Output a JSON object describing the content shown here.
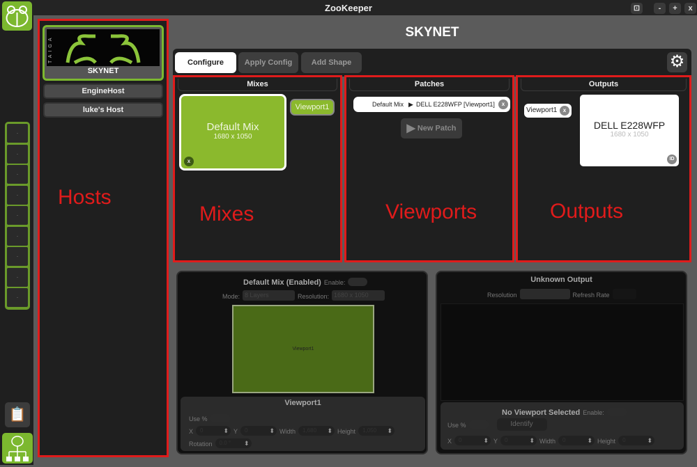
{
  "app": {
    "title": "ZooKeeper",
    "window_buttons": [
      "-",
      "+",
      "x"
    ]
  },
  "sidebar": {
    "slots": [
      ".",
      ".",
      ".",
      ".",
      ".",
      ".",
      ".",
      ".",
      "."
    ]
  },
  "hosts": {
    "items": [
      {
        "label": "SKYNET",
        "selected": true
      },
      {
        "label": "EngineHost"
      },
      {
        "label": "luke's Host"
      }
    ],
    "thumbnail_text": "TAIGA"
  },
  "annotations": {
    "hosts": "Hosts",
    "mixes": "Mixes",
    "viewports": "Viewports",
    "outputs": "Outputs"
  },
  "header": {
    "title": "SKYNET"
  },
  "toolbar": {
    "tabs": [
      {
        "label": "Configure",
        "active": true
      },
      {
        "label": "Apply Config"
      },
      {
        "label": "Add Shape"
      }
    ]
  },
  "mixes": {
    "title": "Mixes",
    "card": {
      "name": "Default Mix",
      "resolution": "1680 x 1050",
      "close": "x"
    },
    "viewport_chip": "Viewport1"
  },
  "patches": {
    "title": "Patches",
    "row": {
      "source": "Default Mix",
      "arrow": "▶",
      "target": "DELL E228WFP [Viewport1]",
      "close": "x"
    },
    "new_patch": "New Patch"
  },
  "outputs": {
    "title": "Outputs",
    "viewport_chip": "Viewport1",
    "chip_close": "x",
    "card": {
      "name": "DELL E228WFP",
      "resolution": "1680 x 1050",
      "id_badge": "ID"
    }
  },
  "mix_editor": {
    "title": "Default Mix (Enabled)",
    "enable_label": "Enable:",
    "mode_label": "Mode:",
    "mode_value": "8 Layers",
    "resolution_label": "Resolution:",
    "resolution_value": "1680 x 1050",
    "canvas_viewport": "Viewport1",
    "viewport": {
      "title": "Viewport1",
      "use_pct": "Use %",
      "x_label": "X",
      "x": "0",
      "y_label": "Y",
      "y": "0",
      "width_label": "Width",
      "width": "1,680",
      "height_label": "Height",
      "height": "1,050",
      "rotation_label": "Rotation",
      "rotation": "0.0 °"
    }
  },
  "output_editor": {
    "title": "Unknown Output",
    "resolution_label": "Resolution",
    "refresh_label": "Refresh Rate",
    "viewport": {
      "title": "No Viewport Selected",
      "enable_label": "Enable:",
      "use_pct": "Use %",
      "identify": "Identify",
      "x_label": "X",
      "x": "0",
      "y_label": "Y",
      "y": "0",
      "width_label": "Width",
      "width": "0",
      "height_label": "Height",
      "height": "0"
    }
  }
}
